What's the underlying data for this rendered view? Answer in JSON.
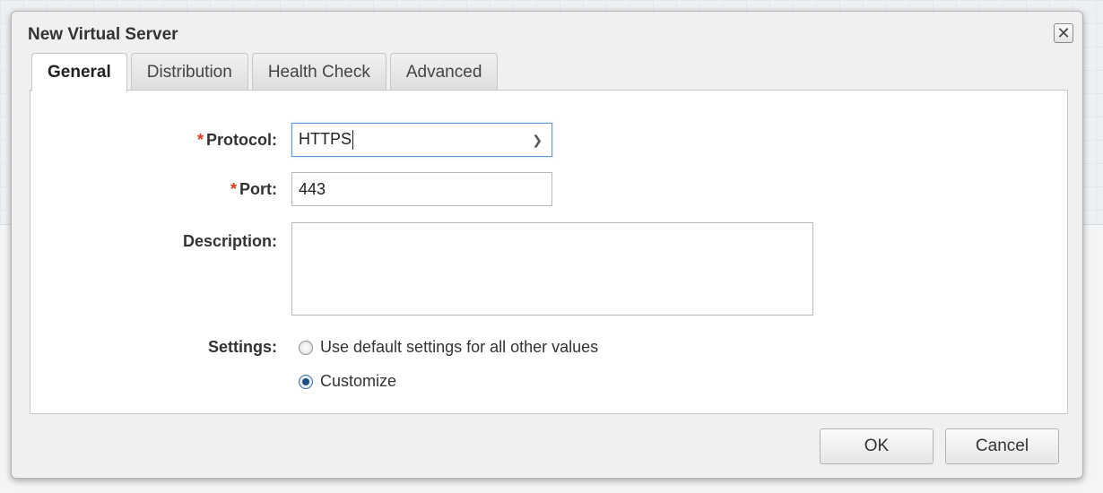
{
  "dialog": {
    "title": "New Virtual Server",
    "close_icon": "close-icon"
  },
  "tabs": [
    {
      "label": "General",
      "active": true
    },
    {
      "label": "Distribution",
      "active": false
    },
    {
      "label": "Health Check",
      "active": false
    },
    {
      "label": "Advanced",
      "active": false
    }
  ],
  "form": {
    "protocol": {
      "required_mark": "*",
      "label": "Protocol:",
      "value": "HTTPS"
    },
    "port": {
      "required_mark": "*",
      "label": "Port:",
      "value": "443"
    },
    "description": {
      "label": "Description:",
      "value": ""
    },
    "settings": {
      "label": "Settings:",
      "options": [
        {
          "label": "Use default settings for all other values",
          "checked": false
        },
        {
          "label": "Customize",
          "checked": true
        }
      ]
    }
  },
  "buttons": {
    "ok": "OK",
    "cancel": "Cancel"
  },
  "colors": {
    "required": "#d9361c",
    "focus_border": "#5b9dd9"
  }
}
